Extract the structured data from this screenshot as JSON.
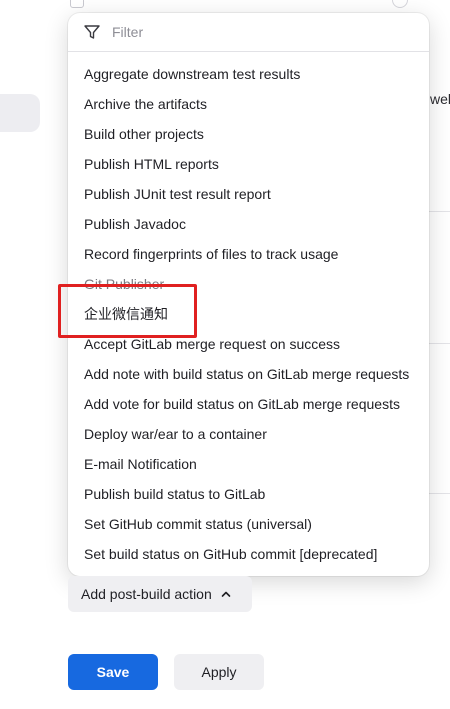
{
  "background": {
    "cut_text": "wel"
  },
  "dropdown": {
    "filter_placeholder": "Filter",
    "filter_value": "",
    "items": [
      {
        "label": "Aggregate downstream test results"
      },
      {
        "label": "Archive the artifacts"
      },
      {
        "label": "Build other projects"
      },
      {
        "label": "Publish HTML reports"
      },
      {
        "label": "Publish JUnit test result report"
      },
      {
        "label": "Publish Javadoc"
      },
      {
        "label": "Record fingerprints of files to track usage"
      },
      {
        "label": "Git Publisher"
      },
      {
        "label": "企业微信通知"
      },
      {
        "label": "Accept GitLab merge request on success"
      },
      {
        "label": "Add note with build status on GitLab merge requests"
      },
      {
        "label": "Add vote for build status on GitLab merge requests"
      },
      {
        "label": "Deploy war/ear to a container"
      },
      {
        "label": "E-mail Notification"
      },
      {
        "label": "Publish build status to GitLab"
      },
      {
        "label": "Set GitHub commit status (universal)"
      },
      {
        "label": "Set build status on GitHub commit [deprecated]"
      }
    ]
  },
  "actions": {
    "add_post_build_label": "Add post-build action",
    "save_label": "Save",
    "apply_label": "Apply"
  },
  "colors": {
    "primary": "#1769e0",
    "highlight": "#e02020",
    "secondary_bg": "#efeff2"
  }
}
